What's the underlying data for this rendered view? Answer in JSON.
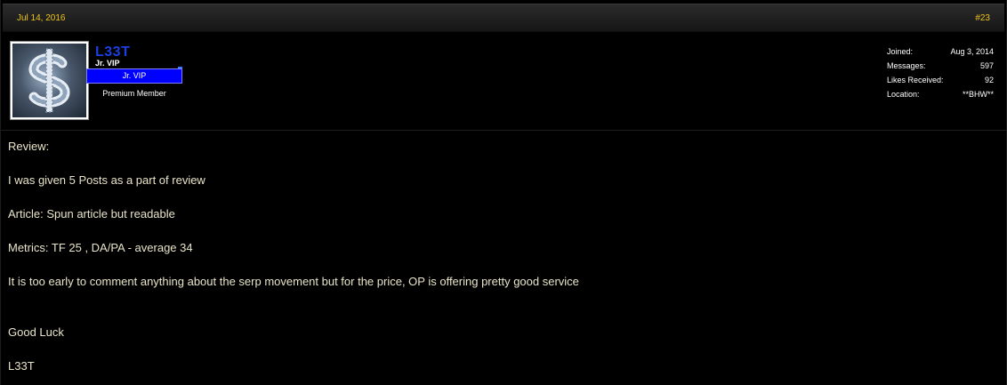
{
  "post": {
    "date": "Jul 14, 2016",
    "number": "#23"
  },
  "user": {
    "username": "L33T",
    "title": "Jr. VIP",
    "rank_banner": "Jr. VIP",
    "member_type": "Premium Member",
    "stats": [
      {
        "label": "Joined:",
        "value": "Aug 3, 2014"
      },
      {
        "label": "Messages:",
        "value": "597"
      },
      {
        "label": "Likes Received:",
        "value": "92"
      },
      {
        "label": "Location:",
        "value": "**BHW**"
      }
    ],
    "avatar_icon": "dollar-sign-icon"
  },
  "body": {
    "lines": [
      "Review:",
      "I was given 5 Posts as a part of review",
      "Article: Spun article but readable",
      "Metrics: TF 25 , DA/PA - average 34",
      "It is too early to comment anything about the serp movement but for the price, OP is offering pretty good service",
      "Good Luck",
      "L33T"
    ]
  },
  "colors": {
    "date_text": "#f0c419",
    "username": "#1b3fe0",
    "rank_banner_bg": "#0000ff",
    "body_text": "#e8e4c9"
  }
}
